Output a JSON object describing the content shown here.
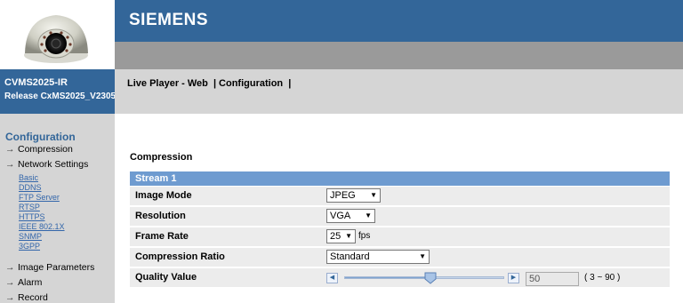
{
  "brand": "SIEMENS",
  "product": {
    "model": "CVMS2025-IR",
    "release": "Release CxMS2025_V2305"
  },
  "menu": {
    "live_player": "Live Player - Web",
    "configuration": "Configuration",
    "separator": "|"
  },
  "sidebar": {
    "title": "Configuration",
    "items": [
      {
        "label": "Compression"
      },
      {
        "label": "Network Settings",
        "subitems": [
          "Basic",
          "DDNS",
          "FTP Server",
          "RTSP",
          "HTTPS",
          "IEEE 802.1X",
          "SNMP",
          "3GPP"
        ]
      },
      {
        "label": "Image Parameters"
      },
      {
        "label": "Alarm"
      },
      {
        "label": "Record"
      }
    ]
  },
  "section": {
    "title": "Compression",
    "stream_label": "Stream 1",
    "fields": {
      "image_mode": {
        "label": "Image Mode",
        "value": "JPEG"
      },
      "resolution": {
        "label": "Resolution",
        "value": "VGA"
      },
      "frame_rate": {
        "label": "Frame Rate",
        "value": "25",
        "unit": "fps"
      },
      "compression_ratio": {
        "label": "Compression Ratio",
        "value": "Standard"
      },
      "quality": {
        "label": "Quality Value",
        "value": "50",
        "range": "( 3 ~ 90 )",
        "min": 3,
        "max": 90
      }
    }
  },
  "icons": {
    "nav_arrow": "→",
    "dropdown": "▼",
    "slider_left": "◀",
    "slider_right": "▶"
  },
  "colors": {
    "header_blue": "#336699",
    "stream_bar": "#6e9bd0",
    "nav_gray": "#d5d5d5",
    "row_gray": "#ececec"
  }
}
